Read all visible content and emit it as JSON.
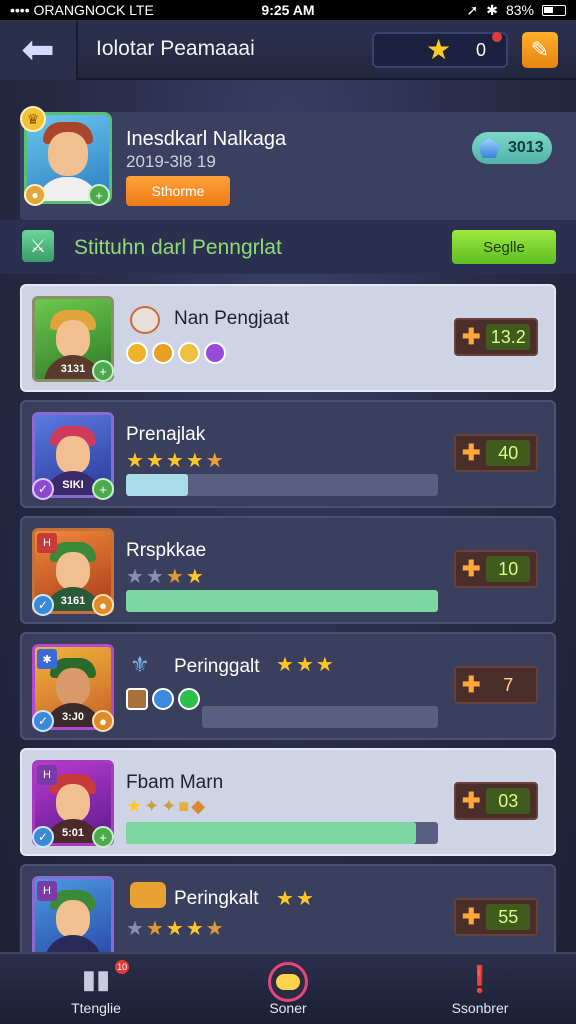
{
  "status_bar": {
    "carrier": "•••• ORANGNOCK LTE",
    "time": "9:25 AM",
    "battery": "83%"
  },
  "header": {
    "back_icon": "back-arrow-icon",
    "title": "Iolotar Peamaaai",
    "currency_icon": "star-icon",
    "currency_value": "0",
    "menu_icon": "menu-icon"
  },
  "profile": {
    "name": "Inesdkarl Nalkaga",
    "date": "2019-3l8 19",
    "button_label": "Sthorme",
    "gem_value": "3013"
  },
  "section": {
    "title": "Stittuhn darl Penngrlat",
    "button_label": "Seglle"
  },
  "rankings": [
    {
      "name": "Nan Pengjaat",
      "caption": "3131",
      "score": "13.2",
      "stars_on": 0,
      "stars_off": 0,
      "progress": null
    },
    {
      "name": "Prenajlak",
      "caption": "SIKI",
      "score": "40",
      "stars_on": 5,
      "stars_off": 0,
      "progress": 0.2
    },
    {
      "name": "Rrspkkae",
      "caption": "3161",
      "score": "10",
      "stars_on": 2,
      "stars_off": 2,
      "progress": 1.0
    },
    {
      "name": "Peringgalt",
      "caption": "3:J0",
      "score": "7",
      "stars_on": 3,
      "stars_off": 0,
      "progress": 0.0
    },
    {
      "name": "Fbam Marn",
      "caption": "5:01",
      "score": "03",
      "stars_on": 4,
      "stars_off": 0,
      "progress": 0.93
    },
    {
      "name": "Peringkalt",
      "caption": "",
      "score": "55",
      "stars_on": 4,
      "stars_off": 1,
      "progress": null
    }
  ],
  "nav": [
    {
      "label": "Ttenglie",
      "icon": "chart-icon",
      "badge": "10"
    },
    {
      "label": "Soner",
      "icon": "controller-icon"
    },
    {
      "label": "Ssonbrer",
      "icon": "alert-icon"
    }
  ],
  "colors": {
    "accent_orange": "#f08a1a",
    "accent_green": "#6ccf2c",
    "progress_blue": "#a8dce8",
    "progress_green": "#7ad8a0"
  }
}
